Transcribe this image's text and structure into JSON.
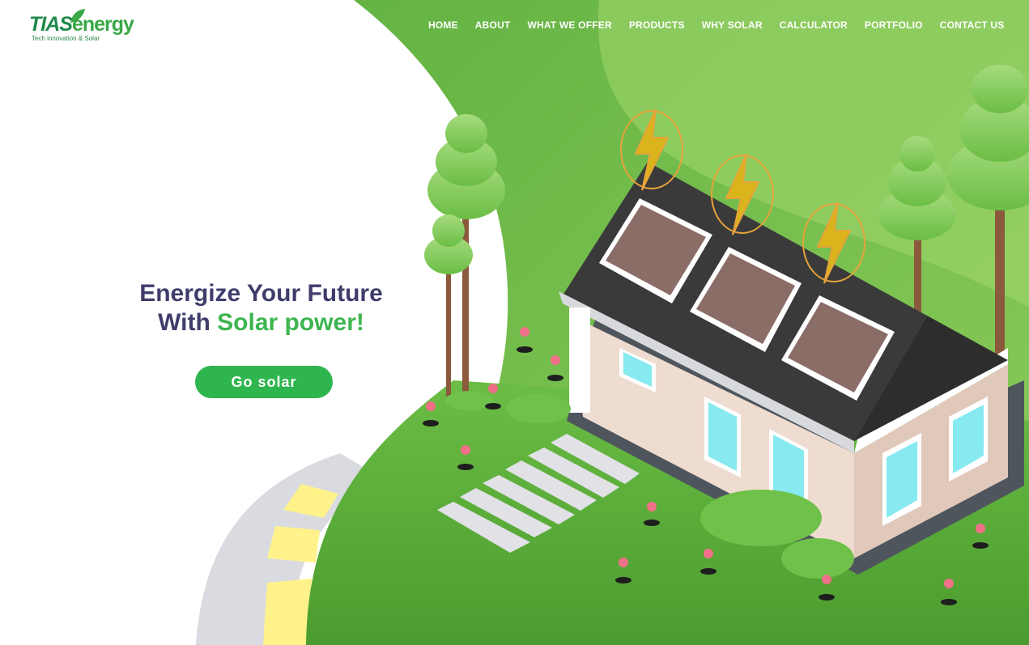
{
  "brand": {
    "name_part1": "TIAS",
    "name_part2": "energy",
    "tagline": "Tech innovation & Solar"
  },
  "nav": {
    "items": [
      {
        "label": "HOME"
      },
      {
        "label": "ABOUT"
      },
      {
        "label": "WHAT WE OFFER"
      },
      {
        "label": "PRODUCTS"
      },
      {
        "label": "WHY SOLAR"
      },
      {
        "label": "CALCULATOR"
      },
      {
        "label": "PORTFOLIO"
      },
      {
        "label": "CONTACT US"
      }
    ]
  },
  "hero": {
    "line1": "Energize Your Future",
    "line2_prefix": "With ",
    "line2_accent": "Solar power!",
    "cta_label": "Go solar"
  },
  "colors": {
    "heading": "#3f3d6b",
    "accent": "#3db550",
    "button": "#2fb54d",
    "grass": "#5fb83f",
    "roof": "#3a3a3a"
  }
}
